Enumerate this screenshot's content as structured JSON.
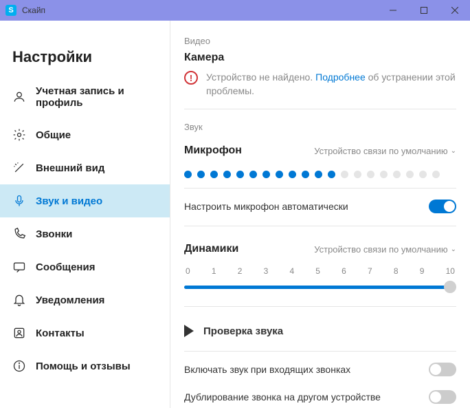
{
  "window": {
    "title": "Скайп"
  },
  "sidebar": {
    "heading": "Настройки",
    "items": [
      {
        "label": "Учетная запись и профиль"
      },
      {
        "label": "Общие"
      },
      {
        "label": "Внешний вид"
      },
      {
        "label": "Звук и видео"
      },
      {
        "label": "Звонки"
      },
      {
        "label": "Сообщения"
      },
      {
        "label": "Уведомления"
      },
      {
        "label": "Контакты"
      },
      {
        "label": "Помощь и отзывы"
      }
    ]
  },
  "video": {
    "section": "Видео",
    "title": "Камера",
    "error_pre": "Устройство не найдено. ",
    "error_link": "Подробнее",
    "error_post": " об устранении этой проблемы."
  },
  "audio": {
    "section": "Звук",
    "mic_title": "Микрофон",
    "mic_device": "Устройство связи по умолчанию",
    "mic_level_active": 12,
    "mic_level_total": 20,
    "auto_mic": "Настроить микрофон автоматически",
    "auto_mic_on": true,
    "speakers_title": "Динамики",
    "speakers_device": "Устройство связи по умолчанию",
    "slider_ticks": [
      "0",
      "1",
      "2",
      "3",
      "4",
      "5",
      "6",
      "7",
      "8",
      "9",
      "10"
    ],
    "slider_value": 10,
    "test_label": "Проверка звука",
    "ring_on_incoming": "Включать звук при входящих звонках",
    "ring_on_incoming_on": false,
    "ring_other_device": "Дублирование звонка на другом устройстве",
    "ring_other_device_on": false
  }
}
